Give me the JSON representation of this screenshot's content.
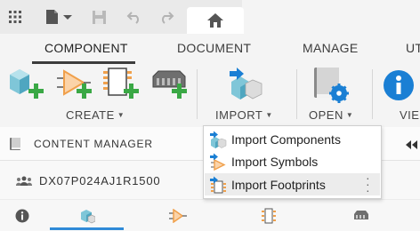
{
  "ribbon": {
    "tabs": [
      {
        "label": "COMPONENT",
        "active": true
      },
      {
        "label": "DOCUMENT",
        "active": false
      },
      {
        "label": "MANAGE",
        "active": false
      },
      {
        "label": "UT",
        "active": false
      }
    ],
    "groups": {
      "create": "CREATE",
      "import": "IMPORT",
      "open": "OPEN",
      "view_partial": "VIE"
    }
  },
  "import_menu": {
    "items": [
      {
        "label": "Import Components",
        "icon": "import-components-icon"
      },
      {
        "label": "Import Symbols",
        "icon": "import-symbols-icon"
      },
      {
        "label": "Import Footprints",
        "icon": "import-footprints-icon",
        "highlighted": true
      }
    ]
  },
  "panel": {
    "content_manager_title": "CONTENT MANAGER",
    "part_name": "DX07P024AJ1R1500",
    "active_bottom_tab": "3d-package"
  },
  "colors": {
    "accent_blue": "#2f8ad8",
    "green_plus": "#3aa845",
    "symbol_orange": "#f0a04b",
    "info_blue": "#1a7fd4"
  }
}
